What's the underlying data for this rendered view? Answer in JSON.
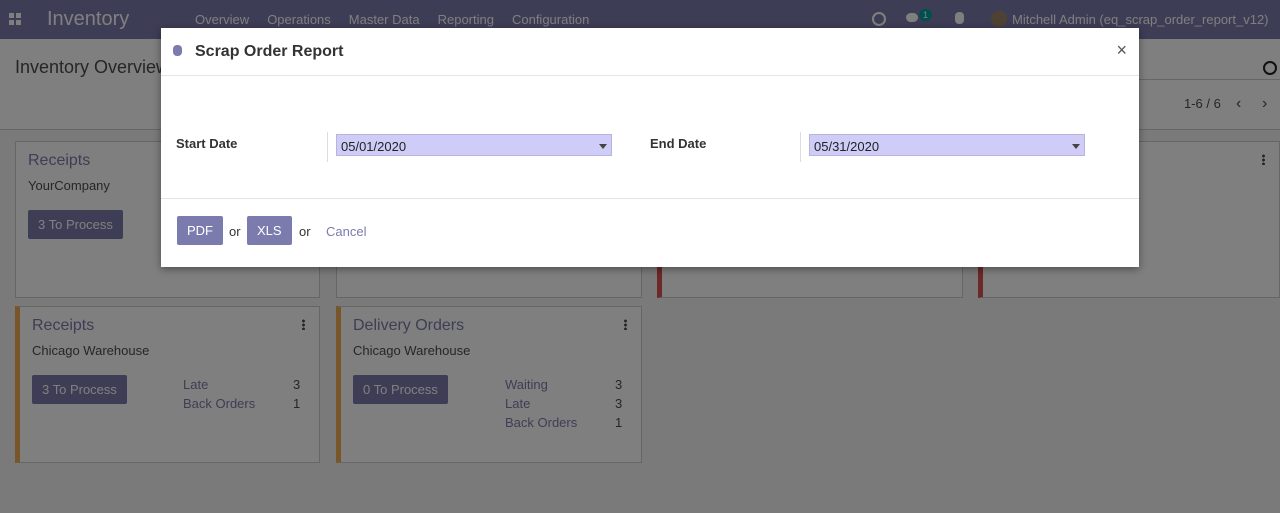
{
  "navbar": {
    "app_title": "Inventory",
    "menu": [
      "Overview",
      "Operations",
      "Master Data",
      "Reporting",
      "Configuration"
    ],
    "chat_badge": "1",
    "user": "Mitchell Admin (eq_scrap_order_report_v12)"
  },
  "control_panel": {
    "breadcrumb": "Inventory Overview",
    "pager": "1-6 / 6"
  },
  "kanban": {
    "cards": [
      {
        "title": "Receipts",
        "subtitle": "YourCompany",
        "button": "3 To Process"
      },
      {
        "title": "Receipts",
        "subtitle": "Chicago Warehouse",
        "button": "3 To Process",
        "stats": [
          {
            "label": "Late",
            "value": "3"
          },
          {
            "label": "Back Orders",
            "value": "1"
          }
        ]
      },
      {
        "title": "Delivery Orders",
        "subtitle": "Chicago Warehouse",
        "button": "0 To Process",
        "stats": [
          {
            "label": "Waiting",
            "value": "3"
          },
          {
            "label": "Late",
            "value": "3"
          },
          {
            "label": "Back Orders",
            "value": "1"
          }
        ]
      }
    ]
  },
  "modal": {
    "title": "Scrap Order Report",
    "close": "×",
    "start_label": "Start Date",
    "start_value": "05/01/2020",
    "end_label": "End Date",
    "end_value": "05/31/2020",
    "pdf_label": "PDF",
    "or1": "or",
    "xls_label": "XLS",
    "or2": "or",
    "cancel_label": "Cancel"
  },
  "colors": {
    "brand": "#7c7bad",
    "date_field_bg": "#cfcdf8",
    "card_border_orange": "#f0ad4e",
    "card_border_red": "#d9534f"
  }
}
